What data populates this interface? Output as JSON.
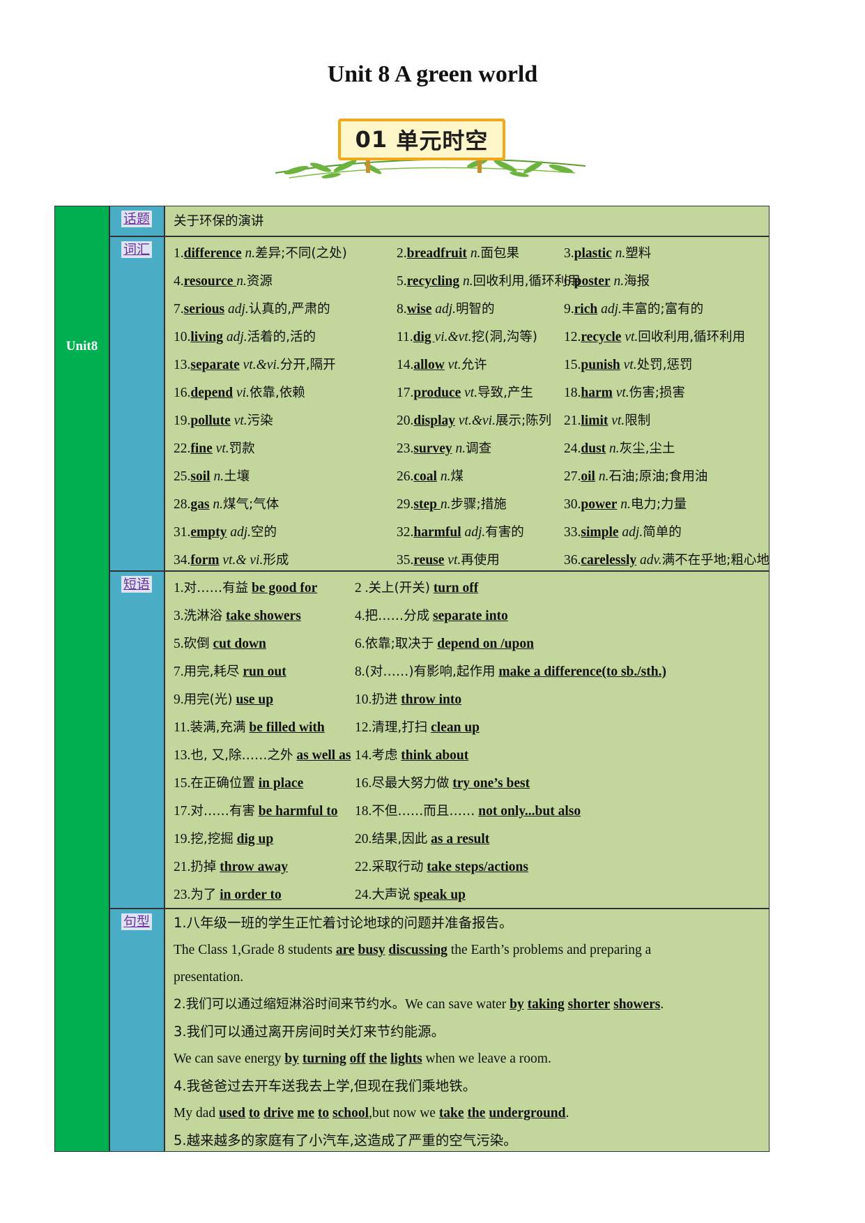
{
  "title": "Unit 8 A green world",
  "banner": {
    "number": "01",
    "text": "单元时空"
  },
  "unit_label": "Unit8",
  "categories": {
    "topic": "话题",
    "vocab": "词汇",
    "phrases": "短语",
    "sentences": "句型"
  },
  "topic_text": "关于环保的演讲",
  "vocab": [
    {
      "n": "1.",
      "w": "difference",
      "pos": "n.",
      "m": "差异;不同(之处)"
    },
    {
      "n": "2.",
      "w": "breadfruit",
      "pos": "n.",
      "m": "面包果"
    },
    {
      "n": "3.",
      "w": "plastic",
      "pos": "n.",
      "m": "塑料"
    },
    {
      "n": "4.",
      "w": "resource ",
      "pos": "n.",
      "m": "资源"
    },
    {
      "n": "5.",
      "w": "recycling",
      "pos": "n.",
      "m": "回收利用,循环利用"
    },
    {
      "n": "6.",
      "w": "poster",
      "pos": "n.",
      "m": "海报"
    },
    {
      "n": "7.",
      "w": "serious",
      "pos": "adj.",
      "m": "认真的,严肃的"
    },
    {
      "n": "8.",
      "w": "wise",
      "pos": "adj.",
      "m": "明智的"
    },
    {
      "n": "9.",
      "w": "rich",
      "pos": "adj.",
      "m": "丰富的;富有的"
    },
    {
      "n": "10.",
      "w": "living",
      "pos": "adj.",
      "m": "活着的,活的"
    },
    {
      "n": "11.",
      "w": "dig ",
      "pos": "vi.&vt.",
      "m": "挖(洞,沟等)"
    },
    {
      "n": "12.",
      "w": "recycle",
      "pos": "vt.",
      "m": "回收利用,循环利用"
    },
    {
      "n": "13.",
      "w": "separate",
      "pos": "vt.&vi.",
      "m": "分开,隔开"
    },
    {
      "n": "14.",
      "w": "allow",
      "pos": "vt.",
      "m": "允许"
    },
    {
      "n": "15.",
      "w": "punish",
      "pos": "vt.",
      "m": "处罚,惩罚"
    },
    {
      "n": "16.",
      "w": "depend",
      "pos": "vi.",
      "m": "依靠,依赖"
    },
    {
      "n": "17.",
      "w": "produce",
      "pos": "vt.",
      "m": "导致,产生"
    },
    {
      "n": "18.",
      "w": "harm",
      "pos": "vt.",
      "m": "伤害;损害"
    },
    {
      "n": "19.",
      "w": "pollute",
      "pos": "vt.",
      "m": "污染"
    },
    {
      "n": "20.",
      "w": "display",
      "pos": "vt.&vi.",
      "m": "展示;陈列"
    },
    {
      "n": "21.",
      "w": "limit",
      "pos": "vt.",
      "m": "限制"
    },
    {
      "n": "22.",
      "w": "fine",
      "pos": "vt.",
      "m": "罚款"
    },
    {
      "n": "23.",
      "w": "survey",
      "pos": "n.",
      "m": "调查"
    },
    {
      "n": "24.",
      "w": "dust",
      "pos": "n.",
      "m": "灰尘,尘土"
    },
    {
      "n": "25.",
      "w": "soil",
      "pos": "n.",
      "m": "土壤"
    },
    {
      "n": "26.",
      "w": "coal",
      "pos": "n.",
      "m": "煤"
    },
    {
      "n": "27.",
      "w": "oil",
      "pos": "n.",
      "m": "石油;原油;食用油"
    },
    {
      "n": "28.",
      "w": "gas",
      "pos": "n.",
      "m": "煤气;气体"
    },
    {
      "n": "29.",
      "w": "step ",
      "pos": "n.",
      "m": "步骤;措施"
    },
    {
      "n": "30.",
      "w": "power",
      "pos": "n.",
      "m": "电力;力量"
    },
    {
      "n": "31.",
      "w": "empty",
      "pos": "adj.",
      "m": "空的"
    },
    {
      "n": "32.",
      "w": "harmful",
      "pos": "adj.",
      "m": "有害的"
    },
    {
      "n": "33.",
      "w": "simple",
      "pos": "adj.",
      "m": "简单的"
    },
    {
      "n": "34.",
      "w": "form",
      "pos": "vt.& vi.",
      "m": "形成"
    },
    {
      "n": "35.",
      "w": "reuse",
      "pos": "vt.",
      "m": "再使用"
    },
    {
      "n": "36.",
      "w": "carelessly",
      "pos": "adv.",
      "m": "满不在乎地;粗心地"
    }
  ],
  "phrases": [
    {
      "n": "1.",
      "zh": "对……有益",
      "en": "be good for "
    },
    {
      "n": "2 .",
      "zh": "关上(开关)",
      "en": "turn off"
    },
    {
      "n": "3.",
      "zh": "洗淋浴",
      "en": " take showers "
    },
    {
      "n": "4.",
      "zh": "把……分成",
      "en": " separate into"
    },
    {
      "n": "5.",
      "zh": "砍倒",
      "en": "cut down "
    },
    {
      "n": "6.",
      "zh": "依靠;取决于",
      "en": "depend on /upon"
    },
    {
      "n": "7.",
      "zh": "用完,耗尽",
      "en": " run out"
    },
    {
      "n": "8.",
      "zh": "(对……)有影响,起作用",
      "en": "make a difference(to sb./sth.)"
    },
    {
      "n": "9.",
      "zh": "用完(光)",
      "en": "use up "
    },
    {
      "n": "10.",
      "zh": "扔进",
      "en": "throw into"
    },
    {
      "n": "11.",
      "zh": "装满,充满",
      "en": "be filled with"
    },
    {
      "n": "12.",
      "zh": "清理,打扫",
      "en": "clean up"
    },
    {
      "n": "13.",
      "zh": "也, 又,除……之外",
      "en": "as well as "
    },
    {
      "n": "14.",
      "zh": "考虑",
      "en": "think about"
    },
    {
      "n": "15.",
      "zh": "在正确位置",
      "en": "in place"
    },
    {
      "n": "16.",
      "zh": "尽最大努力做",
      "en": "try one’s best"
    },
    {
      "n": "17.",
      "zh": "对……有害",
      "en": "be harmful to"
    },
    {
      "n": "18.",
      "zh": "不但……而且……",
      "en": " not only...but also"
    },
    {
      "n": "19.",
      "zh": "挖,挖掘",
      "en": "dig up "
    },
    {
      "n": "20.",
      "zh": "结果,因此",
      "en": "as a result"
    },
    {
      "n": "21.",
      "zh": "扔掉",
      "en": "throw away "
    },
    {
      "n": "22.",
      "zh": "采取行动",
      "en": "take steps/actions"
    },
    {
      "n": "23.",
      "zh": "为了",
      "en": "in order to "
    },
    {
      "n": "24.",
      "zh": "大声说",
      "en": " speak up"
    }
  ],
  "sentences": {
    "s1_zh": "1.八年级一班的学生正忙着讨论地球的问题并准备报告。",
    "s1_en_a": "The Class 1,Grade 8 students ",
    "s1_en_u1": "are",
    "s1_en_u2": "busy",
    "s1_en_u3": "discussing",
    "s1_en_b": " the Earth’s problems and preparing a",
    "s1_en_c": "presentation.",
    "s2_zh": "2.我们可以通过缩短淋浴时间来节约水。",
    "s2_en_a": "We can save water ",
    "s2_en_u1": "by",
    "s2_en_u2": "taking",
    "s2_en_u3": "shorter",
    "s2_en_u4": "showers",
    "s2_en_b": ".",
    "s3_zh": "3.我们可以通过离开房间时关灯来节约能源。",
    "s3_en_a": "We can save energy ",
    "s3_en_u1": "by",
    "s3_en_u2": "turning",
    "s3_en_u3": "off",
    "s3_en_u4": "the",
    "s3_en_u5": "lights",
    "s3_en_b": " when we leave a room.",
    "s4_zh": "4.我爸爸过去开车送我去上学,但现在我们乘地铁。",
    "s4_en_a": "My dad ",
    "s4_en_u1": "used",
    "s4_en_u2": "to",
    "s4_en_u3": "drive",
    "s4_en_u4": "me",
    "s4_en_u5": "to",
    "s4_en_u6": "school",
    "s4_en_b": ",but now we ",
    "s4_en_u7": "take",
    "s4_en_u8": "the",
    "s4_en_u9": "underground",
    "s4_en_c": ".",
    "s5_zh": "5.越来越多的家庭有了小汽车,这造成了严重的空气污染。"
  }
}
